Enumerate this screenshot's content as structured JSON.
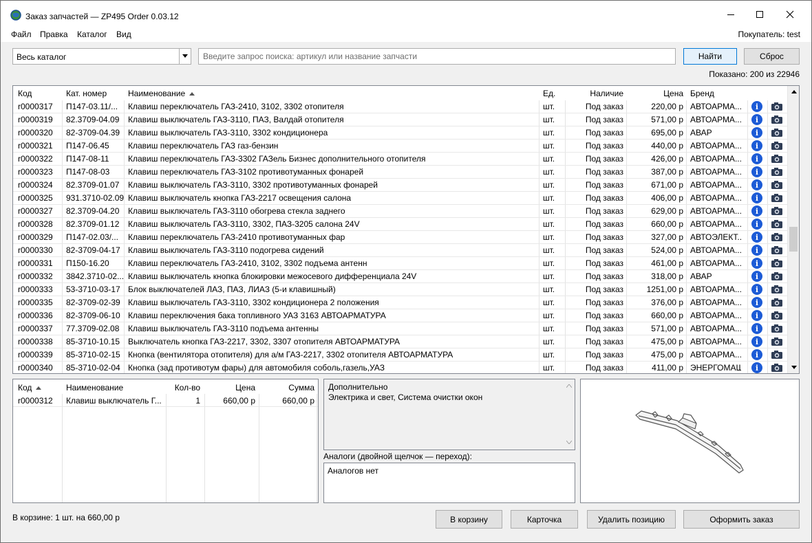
{
  "window": {
    "title": "Заказ запчастей — ZP495 Order 0.03.12"
  },
  "menu": {
    "items": [
      "Файл",
      "Правка",
      "Каталог",
      "Вид"
    ],
    "buyer": "Покупатель: test"
  },
  "search": {
    "catalog_value": "Весь каталог",
    "placeholder": "Введите запрос поиска: артикул или название запчасти",
    "find_label": "Найти",
    "reset_label": "Сброс",
    "shown": "Показано: 200 из 22946"
  },
  "grid": {
    "headers": {
      "code": "Код",
      "article": "Кат. номер",
      "name": "Наименование",
      "unit": "Ед.",
      "avail": "Наличие",
      "price": "Цена",
      "brand": "Бренд"
    },
    "rows": [
      {
        "code": "r0000317",
        "article": "П147-03.11/...",
        "name": "Клавиш переключатель ГАЗ-2410, 3102, 3302 отопителя",
        "unit": "шт.",
        "avail": "Под заказ",
        "price": "220,00 р",
        "brand": "АВТОАРМА..."
      },
      {
        "code": "r0000319",
        "article": "82.3709-04.09",
        "name": "Клавиш выключатель ГАЗ-3110,  ПАЗ,  Валдай отопителя",
        "unit": "шт.",
        "avail": "Под заказ",
        "price": "571,00 р",
        "brand": "АВТОАРМА..."
      },
      {
        "code": "r0000320",
        "article": "82-3709-04.39",
        "name": "Клавиш выключатель ГАЗ-3110, 3302 кондиционера",
        "unit": "шт.",
        "avail": "Под заказ",
        "price": "695,00 р",
        "brand": "АВАР"
      },
      {
        "code": "r0000321",
        "article": "П147-06.45",
        "name": "Клавиш переключатель ГАЗ газ-бензин",
        "unit": "шт.",
        "avail": "Под заказ",
        "price": "440,00 р",
        "brand": "АВТОАРМА..."
      },
      {
        "code": "r0000322",
        "article": "П147-08-11",
        "name": "Клавиш переключатель ГАЗ-3302 ГАЗель Бизнес дополнительного отопителя",
        "unit": "шт.",
        "avail": "Под заказ",
        "price": "426,00 р",
        "brand": "АВТОАРМА..."
      },
      {
        "code": "r0000323",
        "article": "П147-08-03",
        "name": "Клавиш переключатель ГАЗ-3102 противотуманных фонарей",
        "unit": "шт.",
        "avail": "Под заказ",
        "price": "387,00 р",
        "brand": "АВТОАРМА..."
      },
      {
        "code": "r0000324",
        "article": "82.3709-01.07",
        "name": "Клавиш выключатель ГАЗ-3110, 3302 противотуманных фонарей",
        "unit": "шт.",
        "avail": "Под заказ",
        "price": "671,00 р",
        "brand": "АВТОАРМА..."
      },
      {
        "code": "r0000325",
        "article": "931.3710-02.09",
        "name": "Клавиш выключатель кнопка ГАЗ-2217 освещения салона",
        "unit": "шт.",
        "avail": "Под заказ",
        "price": "406,00 р",
        "brand": "АВТОАРМА..."
      },
      {
        "code": "r0000327",
        "article": "82.3709-04.20",
        "name": "Клавиш выключатель ГАЗ-3110 обогрева стекла заднего",
        "unit": "шт.",
        "avail": "Под заказ",
        "price": "629,00 р",
        "brand": "АВТОАРМА..."
      },
      {
        "code": "r0000328",
        "article": "82.3709-01.12",
        "name": "Клавиш выключатель ГАЗ-3110, 3302,  ПАЗ-3205 салона 24V",
        "unit": "шт.",
        "avail": "Под заказ",
        "price": "660,00 р",
        "brand": "АВТОАРМА..."
      },
      {
        "code": "r0000329",
        "article": "П147-02.03/...",
        "name": "Клавиш переключатель ГАЗ-2410 противотуманных фар",
        "unit": "шт.",
        "avail": "Под заказ",
        "price": "327,00 р",
        "brand": "АВТОЭЛЕКТ..."
      },
      {
        "code": "r0000330",
        "article": "82-3709-04-17",
        "name": "Клавиш выключатель ГАЗ-3110 подогрева сидений",
        "unit": "шт.",
        "avail": "Под заказ",
        "price": "524,00 р",
        "brand": "АВТОАРМА..."
      },
      {
        "code": "r0000331",
        "article": "П150-16.20",
        "name": "Клавиш переключатель ГАЗ-2410, 3102, 3302 подъема антенн",
        "unit": "шт.",
        "avail": "Под заказ",
        "price": "461,00 р",
        "brand": "АВТОАРМА..."
      },
      {
        "code": "r0000332",
        "article": "3842.3710-02...",
        "name": "Клавиш выключатель кнопка блокировки межосевого дифференциала 24V",
        "unit": "шт.",
        "avail": "Под заказ",
        "price": "318,00 р",
        "brand": "АВАР"
      },
      {
        "code": "r0000333",
        "article": "53-3710-03-17",
        "name": "Блок выключателей ЛАЗ, ПАЗ, ЛИАЗ (5-и клавишный)",
        "unit": "шт.",
        "avail": "Под заказ",
        "price": "1251,00 р",
        "brand": "АВТОАРМА..."
      },
      {
        "code": "r0000335",
        "article": "82-3709-02-39",
        "name": "Клавиш выключатель ГАЗ-3110, 3302 кондиционера 2 положения",
        "unit": "шт.",
        "avail": "Под заказ",
        "price": "376,00 р",
        "brand": "АВТОАРМА..."
      },
      {
        "code": "r0000336",
        "article": "82-3709-06-10",
        "name": "Клавиш переключения бака топливного УАЗ 3163 АВТОАРМАТУРА",
        "unit": "шт.",
        "avail": "Под заказ",
        "price": "660,00 р",
        "brand": "АВТОАРМА..."
      },
      {
        "code": "r0000337",
        "article": "77.3709-02.08",
        "name": "Клавиш выключатель ГАЗ-3110 подъема антенны",
        "unit": "шт.",
        "avail": "Под заказ",
        "price": "571,00 р",
        "brand": "АВТОАРМА..."
      },
      {
        "code": "r0000338",
        "article": "85-3710-10.15",
        "name": "Выключатель кнопка ГАЗ-2217, 3302, 3307 отопителя АВТОАРМАТУРА",
        "unit": "шт.",
        "avail": "Под заказ",
        "price": "475,00 р",
        "brand": "АВТОАРМА..."
      },
      {
        "code": "r0000339",
        "article": "85-3710-02-15",
        "name": "Кнопка (вентилятора отопителя) для а/м ГАЗ-2217, 3302 отопителя АВТОАРМАТУРА",
        "unit": "шт.",
        "avail": "Под заказ",
        "price": "475,00 р",
        "brand": "АВТОАРМА..."
      },
      {
        "code": "r0000340",
        "article": "85-3710-02-04",
        "name": "Кнопка (зад противотум фары) для автомобиля соболь,газель,УАЗ",
        "unit": "шт.",
        "avail": "Под заказ",
        "price": "411,00 р",
        "brand": "ЭНЕРГОМАШ"
      }
    ]
  },
  "cart": {
    "headers": {
      "code": "Код",
      "name": "Наименование",
      "qty": "Кол-во",
      "price": "Цена",
      "sum": "Сумма"
    },
    "rows": [
      {
        "code": "r0000312",
        "name": "Клавиш выключатель Г...",
        "qty": "1",
        "price": "660,00 р",
        "sum": "660,00 р"
      }
    ],
    "summary": "В корзине: 1 шт. на 660,00 р"
  },
  "details": {
    "title": "Дополнительно",
    "text": "Электрика и свет, Система очистки окон",
    "analogs_label": "Аналоги (двойной щелчок — переход):",
    "analogs_text": "Аналогов нет"
  },
  "buttons": {
    "to_cart": "В корзину",
    "card": "Карточка",
    "delete": "Удалить позицию",
    "order": "Оформить заказ"
  },
  "icons": {
    "info": "info-icon",
    "camera": "camera-icon"
  },
  "colors": {
    "accent": "#0078d7",
    "info": "#1c5bd6"
  }
}
